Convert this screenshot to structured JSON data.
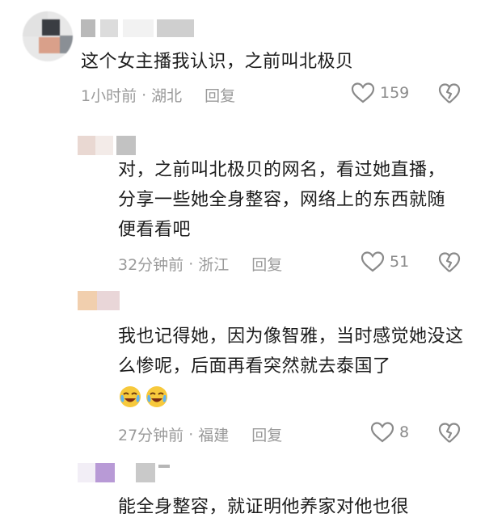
{
  "comments": [
    {
      "text": "这个女主播我认识，之前叫北极贝",
      "time": "1小时前",
      "location": "湖北",
      "reply": "回复",
      "likes": "159"
    },
    {
      "text": "对，之前叫北极贝的网名，看过她直播，分享一些她全身整容，网络上的东西就随便看看吧",
      "time": "32分钟前",
      "location": "浙江",
      "reply": "回复",
      "likes": "51"
    },
    {
      "text": "我也记得她，因为像智雅，当时感觉她没这么惨呢，后面再看突然就去泰国了",
      "emojis": [
        "crying-laughing-emoji",
        "crying-laughing-emoji"
      ],
      "time": "27分钟前",
      "location": "福建",
      "reply": "回复",
      "likes": "8"
    },
    {
      "text": "能全身整容，就证明他养家对他也很"
    }
  ],
  "separator": "·",
  "colors": {
    "text": "#1c1c1c",
    "meta": "#9a9a9a",
    "icon": "#8a8a8a"
  }
}
